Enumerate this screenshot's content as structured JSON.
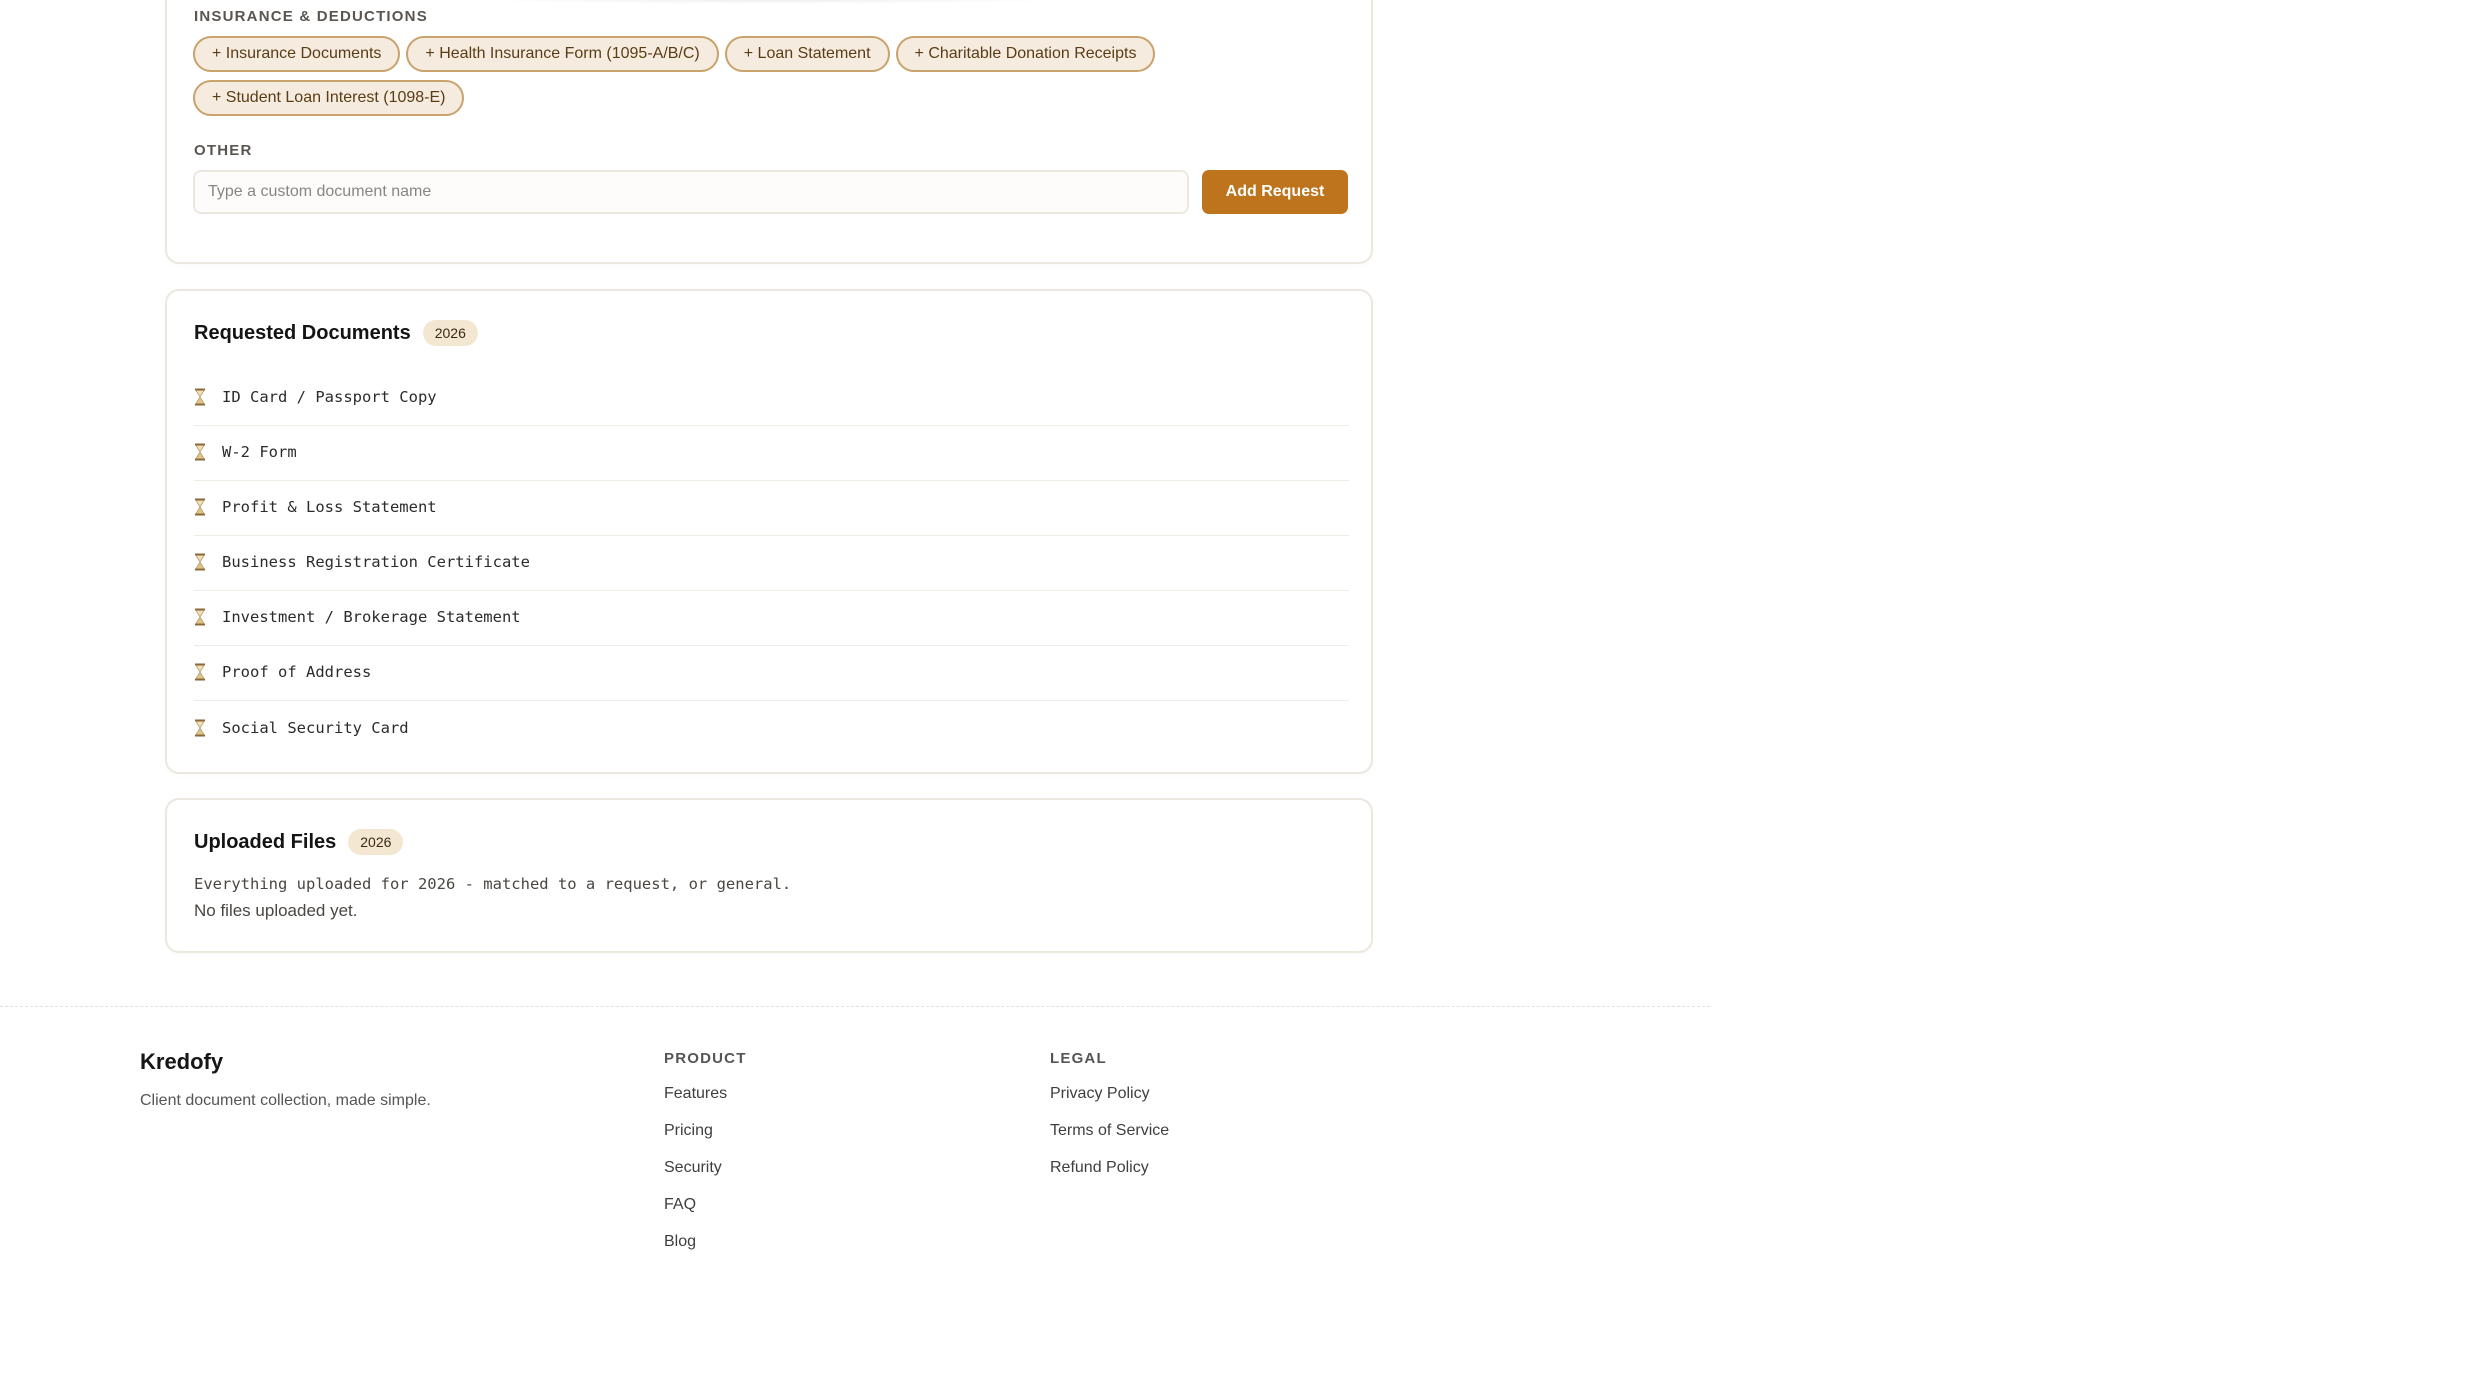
{
  "insurance_section": {
    "label": "INSURANCE & DEDUCTIONS",
    "chips": [
      "+ Insurance Documents",
      "+ Health Insurance Form (1095-A/B/C)",
      "+ Loan Statement",
      "+ Charitable Donation Receipts",
      "+ Student Loan Interest (1098-E)"
    ]
  },
  "other_section": {
    "label": "OTHER",
    "input_placeholder": "Type a custom document name",
    "add_button_label": "Add Request"
  },
  "requested_documents": {
    "title": "Requested Documents",
    "year": "2026",
    "items": [
      "ID Card / Passport Copy",
      "W-2 Form",
      "Profit & Loss Statement",
      "Business Registration Certificate",
      "Investment / Brokerage Statement",
      "Proof of Address",
      "Social Security Card"
    ],
    "status_icon": "hourglass-icon"
  },
  "uploaded_files": {
    "title": "Uploaded Files",
    "year": "2026",
    "description": "Everything uploaded for 2026 - matched to a request, or general.",
    "empty_text": "No files uploaded yet."
  },
  "footer": {
    "brand": "Kredofy",
    "tagline": "Client document collection, made simple.",
    "product": {
      "heading": "PRODUCT",
      "links": [
        "Features",
        "Pricing",
        "Security",
        "FAQ",
        "Blog"
      ]
    },
    "legal": {
      "heading": "LEGAL",
      "links": [
        "Privacy Policy",
        "Terms of Service",
        "Refund Policy"
      ]
    }
  },
  "colors": {
    "accent": "#bd741d",
    "chip_bg": "#f5ecdf",
    "chip_border": "#c9a26e",
    "badge_bg": "#f3e7d2"
  }
}
